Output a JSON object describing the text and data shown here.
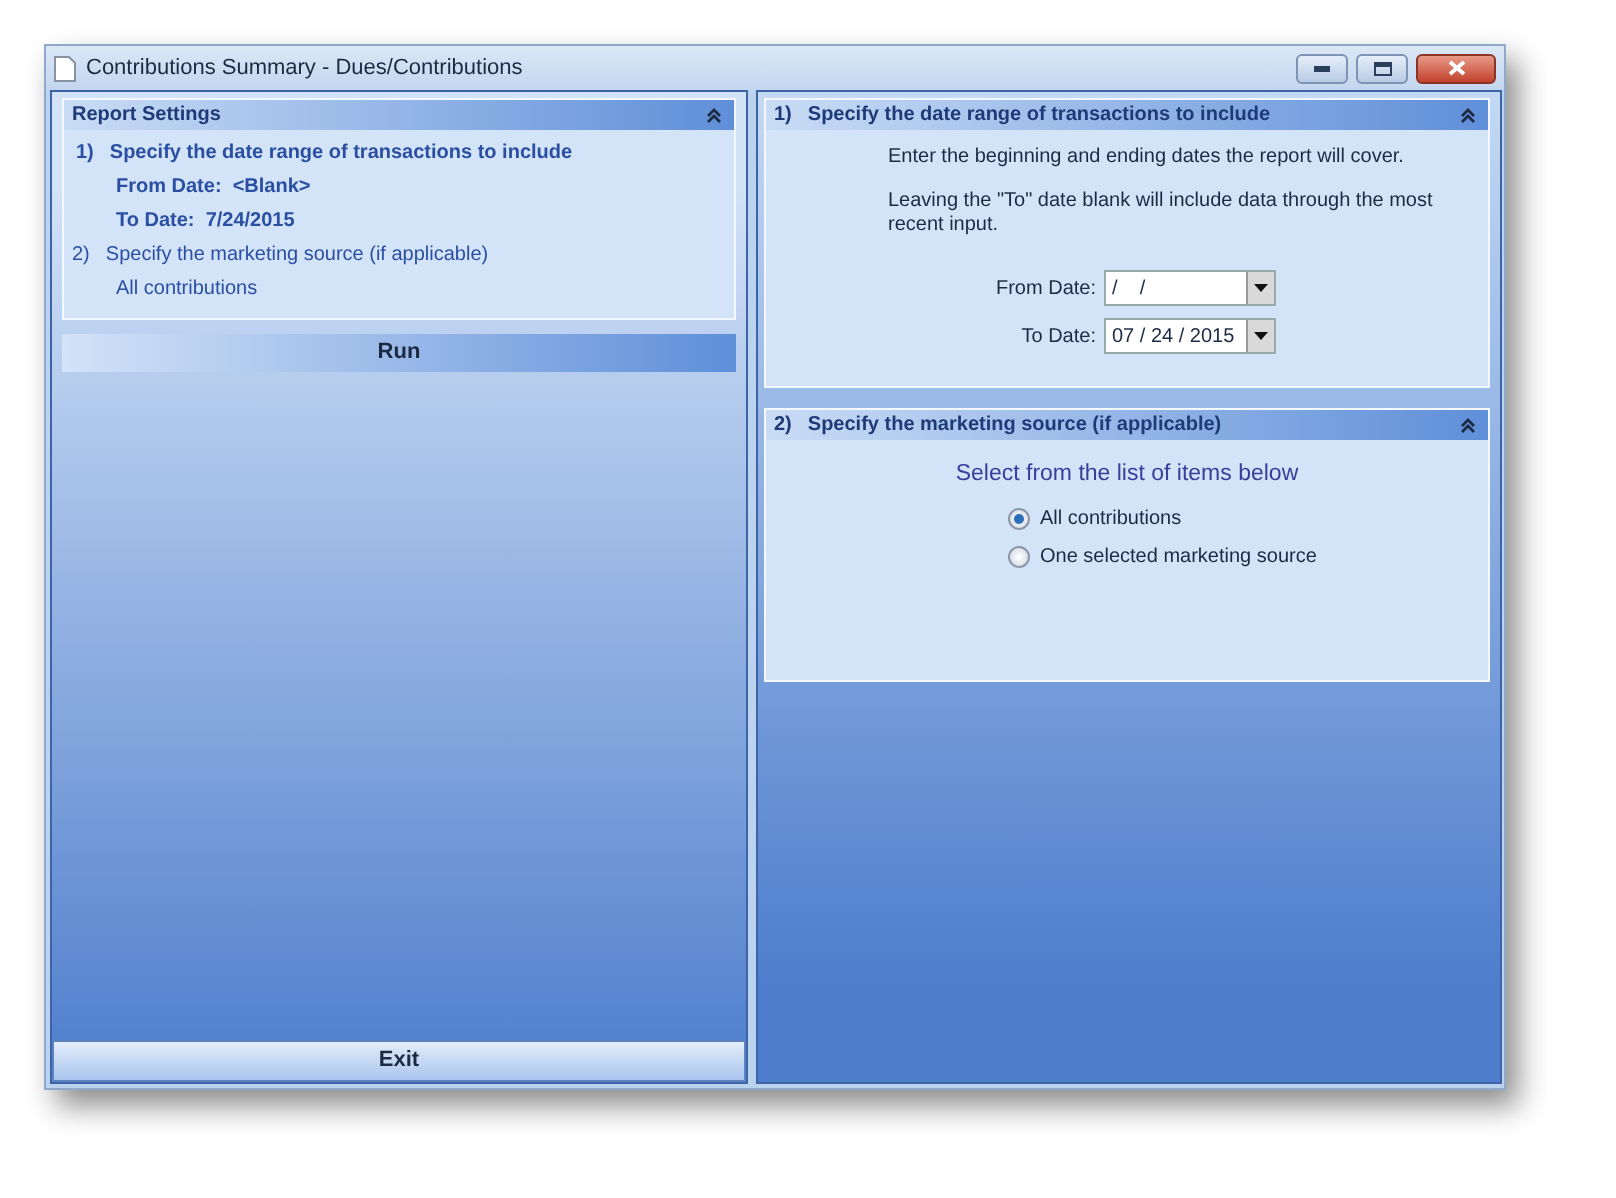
{
  "window": {
    "title": "Contributions Summary - Dues/Contributions"
  },
  "report_settings": {
    "title": "Report Settings",
    "expanded": true,
    "items": [
      {
        "kind": "heading",
        "number": "1)",
        "text": "Specify the date range of transactions to include"
      },
      {
        "kind": "detail",
        "text": "From Date:  <Blank>"
      },
      {
        "kind": "detail",
        "text": "To Date:  7/24/2015"
      },
      {
        "kind": "subheading",
        "number": "2)",
        "text": "Specify the marketing source (if applicable)"
      },
      {
        "kind": "note",
        "text": "All contributions"
      }
    ]
  },
  "run_button": "Run",
  "exit_button": "Exit",
  "sections": [
    {
      "kind": "dates",
      "number": "1)",
      "title": "Specify the date range of transactions to include",
      "expanded": true,
      "notes": [
        "Enter the beginning and ending dates the report will cover.",
        "Leaving the \"To\" date blank will include data through the most recent input."
      ],
      "fields": [
        {
          "label": "From Date:",
          "value": "/    /"
        },
        {
          "label": "To Date:",
          "value": "07 / 24 / 2015"
        }
      ]
    },
    {
      "kind": "source",
      "number": "2)",
      "title": "Specify the marketing source (if applicable)",
      "expanded": true,
      "prompt": "Select from the list of items below",
      "options": [
        {
          "label": "All contributions",
          "selected": true
        },
        {
          "label": "One selected marketing source",
          "selected": false
        }
      ]
    }
  ]
}
